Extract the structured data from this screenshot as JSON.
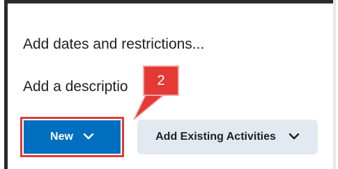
{
  "content": {
    "dates_link": "Add dates and restrictions...",
    "description_link": "Add a descriptio"
  },
  "buttons": {
    "new_label": "New",
    "existing_label": "Add Existing Activities"
  },
  "annotation": {
    "step_number": "2"
  },
  "icons": {
    "new_chevron": "chevron-down-icon",
    "existing_chevron": "chevron-down-icon"
  },
  "colors": {
    "primary_button": "#006fbf",
    "secondary_button": "#e3e9f1",
    "annotation": "#e53935"
  }
}
